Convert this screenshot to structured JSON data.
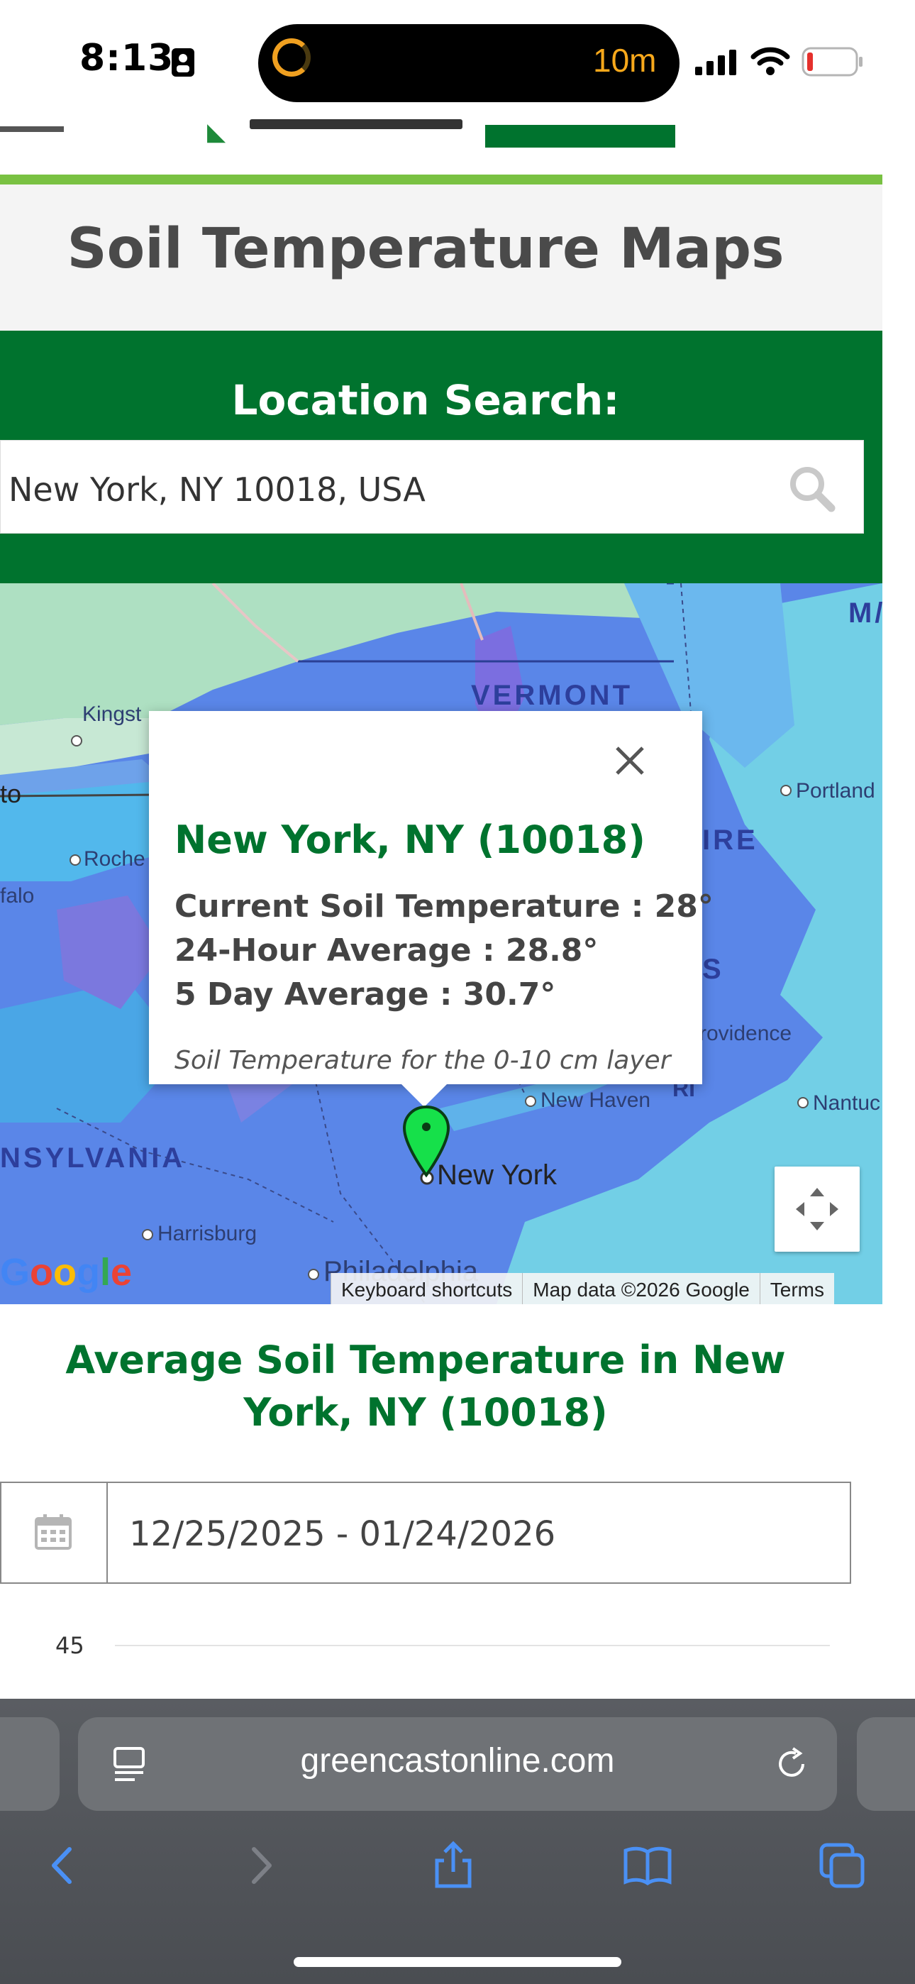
{
  "status_bar": {
    "time": "8:13",
    "activity_timer": "10m"
  },
  "page": {
    "title": "Soil Temperature Maps"
  },
  "search": {
    "label": "Location Search:",
    "value": "New York, NY 10018, USA"
  },
  "map": {
    "region_labels": {
      "vermont": "VERMONT",
      "hampshire_fragment": "IRE",
      "pennsylvania": "NSYLVANIA",
      "maine_fragment": "M/",
      "mass_fragment": "S"
    },
    "city_labels": {
      "kingston": "Kingst",
      "toronto": "to",
      "rochester": "Roche",
      "buffalo": "falo",
      "portland": "Portland",
      "providence": "rovidence",
      "new_haven": "New Haven",
      "nantucket": "Nantuc",
      "new_york": "New York",
      "harrisburg": "Harrisburg",
      "philadelphia": "Philadelphia",
      "ri_fragment": "RI"
    },
    "popup": {
      "title": "New York, NY (10018)",
      "current": "Current Soil Temperature : 28°",
      "avg24": "24-Hour Average : 28.8°",
      "avg5day": "5 Day Average : 30.7°",
      "note": "Soil Temperature for the 0-10 cm layer"
    },
    "attribution": {
      "keyboard": "Keyboard shortcuts",
      "data": "Map data ©2026 Google",
      "terms": "Terms"
    },
    "google_logo": "Google"
  },
  "chart": {
    "title": "Average Soil Temperature in New York, NY (10018)",
    "date_range": "12/25/2025 - 01/24/2026",
    "y_tick": "45"
  },
  "browser": {
    "url": "greencastonline.com"
  }
}
